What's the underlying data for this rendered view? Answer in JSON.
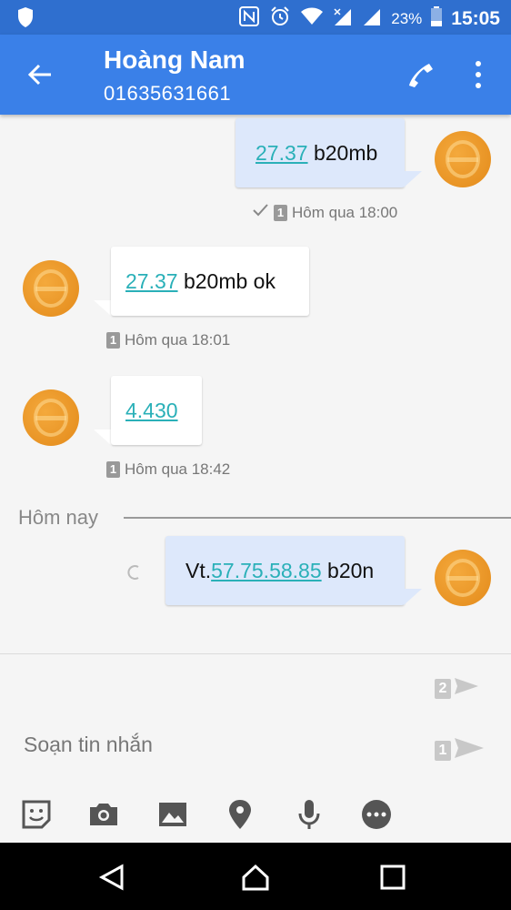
{
  "status_bar": {
    "battery_percent": "23%",
    "time": "15:05",
    "icons": [
      "shield-icon",
      "nfc-icon",
      "alarm-icon",
      "wifi-icon",
      "signal-icon",
      "signal-icon",
      "battery-icon"
    ]
  },
  "header": {
    "contact_name": "Hoàng Nam",
    "phone_number": "01635631661",
    "icons": [
      "back-arrow-icon",
      "phone-icon",
      "more-vert-icon"
    ]
  },
  "messages": [
    {
      "direction": "out",
      "link": "27.37",
      "text": " b20mb",
      "meta": "Hôm qua 18:00",
      "sim": "1"
    },
    {
      "direction": "in",
      "link": "27.37",
      "text": " b20mb ok",
      "meta": "Hôm qua 18:01",
      "sim": "1"
    },
    {
      "direction": "in",
      "link": "4.430",
      "text": "",
      "meta": "Hôm qua 18:42",
      "sim": "1"
    },
    {
      "direction": "out",
      "prefix": "Vt.",
      "link": "57.75.58.85",
      "text": " b20n",
      "meta": "",
      "sim": ""
    }
  ],
  "divider": {
    "label": "Hôm nay"
  },
  "composer": {
    "placeholder": "Soạn tin nhắn",
    "send_sim_2": "2",
    "send_sim_1": "1",
    "attach_icons": [
      "sticker-icon",
      "camera-icon",
      "image-icon",
      "location-icon",
      "microphone-icon",
      "more-options-icon"
    ]
  },
  "colors": {
    "status_bar": "#2f6fcf",
    "toolbar": "#3a80e8",
    "outgoing_bubble": "#dde8fb",
    "incoming_bubble": "#ffffff",
    "link": "#2ab0b8",
    "avatar": "#e8901f"
  }
}
